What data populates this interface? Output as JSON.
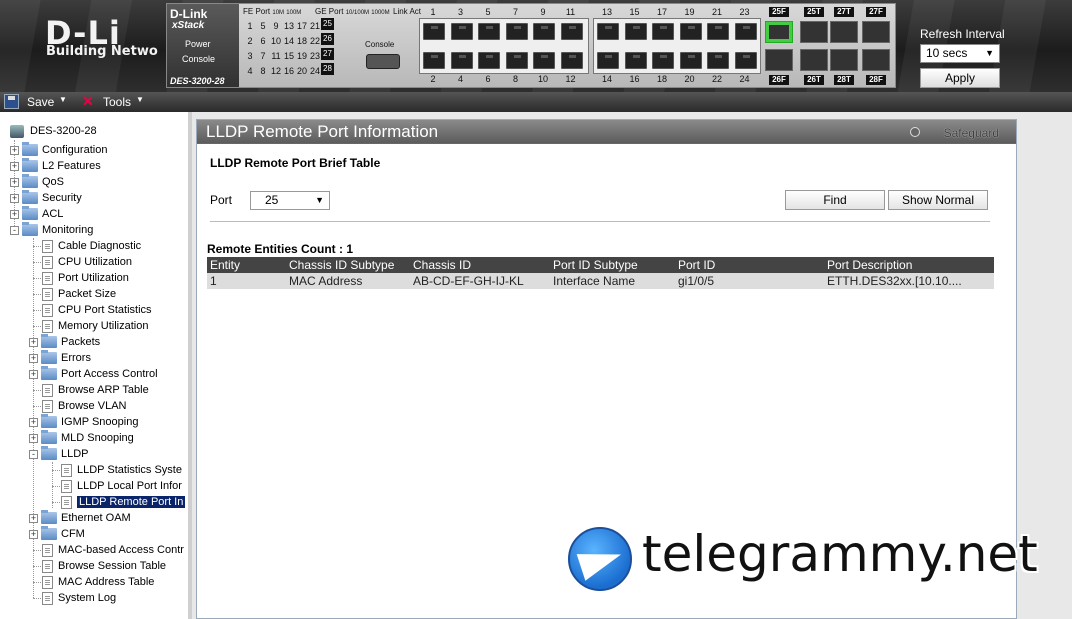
{
  "header": {
    "logo_text": "D-Li",
    "logo_sub": "Building Netwo",
    "device": {
      "brand": "D-Link",
      "xstack": "xStack",
      "power_label": "Power",
      "console_label": "Console",
      "model": "DES-3200-28",
      "fe_label": "FE Port",
      "fe_speeds": [
        "10M",
        "100M"
      ],
      "ge_label": "GE Port",
      "ge_speeds": [
        "10/100M",
        "1000M"
      ],
      "link_label": "Link",
      "act_label": "Act",
      "led_columns": [
        [
          "1",
          "2",
          "3",
          "4"
        ],
        [
          "5",
          "6",
          "7",
          "8"
        ],
        [
          "9",
          "10",
          "11",
          "12"
        ],
        [
          "13",
          "14",
          "15",
          "16"
        ],
        [
          "17",
          "18",
          "19",
          "20"
        ],
        [
          "21",
          "22",
          "23",
          "24"
        ]
      ],
      "ge_ports": [
        "25",
        "26",
        "27",
        "28"
      ],
      "console_port_label": "Console",
      "top_port_numbers": [
        "1",
        "3",
        "5",
        "7",
        "9",
        "11",
        "13",
        "15",
        "17",
        "19",
        "21",
        "23"
      ],
      "bottom_port_numbers": [
        "2",
        "4",
        "6",
        "8",
        "10",
        "12",
        "14",
        "16",
        "18",
        "20",
        "22",
        "24"
      ],
      "sfp_top": [
        "25F",
        "25T",
        "27T",
        "27F"
      ],
      "sfp_bottom": [
        "26F",
        "26T",
        "28T",
        "28F"
      ]
    },
    "refresh_label": "Refresh Interval",
    "refresh_value": "10 secs",
    "apply_label": "Apply"
  },
  "toolbar": {
    "save_label": "Save",
    "tools_label": "Tools"
  },
  "tree": {
    "root": "DES-3200-28",
    "items": [
      {
        "label": "Configuration"
      },
      {
        "label": "L2 Features"
      },
      {
        "label": "QoS"
      },
      {
        "label": "Security"
      },
      {
        "label": "ACL"
      },
      {
        "label": "Monitoring"
      },
      {
        "label": "Cable Diagnostic"
      },
      {
        "label": "CPU Utilization"
      },
      {
        "label": "Port Utilization"
      },
      {
        "label": "Packet Size"
      },
      {
        "label": "CPU Port Statistics"
      },
      {
        "label": "Memory Utilization"
      },
      {
        "label": "Packets"
      },
      {
        "label": "Errors"
      },
      {
        "label": "Port Access Control"
      },
      {
        "label": "Browse ARP Table"
      },
      {
        "label": "Browse VLAN"
      },
      {
        "label": "IGMP Snooping"
      },
      {
        "label": "MLD Snooping"
      },
      {
        "label": "LLDP"
      },
      {
        "label": "LLDP Statistics Syste"
      },
      {
        "label": "LLDP Local Port Infor"
      },
      {
        "label": "LLDP Remote Port In"
      },
      {
        "label": "Ethernet OAM"
      },
      {
        "label": "CFM"
      },
      {
        "label": "MAC-based Access Contr"
      },
      {
        "label": "Browse Session Table"
      },
      {
        "label": "MAC Address Table"
      },
      {
        "label": "System Log"
      }
    ]
  },
  "main": {
    "title": "LLDP Remote Port Information",
    "safeguard": "Safeguard",
    "section_title": "LLDP Remote Port Brief Table",
    "port_label": "Port",
    "port_value": "25",
    "find_label": "Find",
    "show_normal_label": "Show Normal",
    "count_label": "Remote Entities Count  :  1",
    "table": {
      "headers": [
        "Entity",
        "Chassis ID Subtype",
        "Chassis ID",
        "Port ID Subtype",
        "Port ID",
        "Port Description"
      ],
      "rows": [
        [
          "1",
          "MAC Address",
          "AB-CD-EF-GH-IJ-KL",
          "Interface Name",
          "gi1/0/5",
          "ETTH.DES32xx.[10.10...."
        ]
      ]
    }
  },
  "watermark": {
    "text": "telegrammy.net"
  }
}
